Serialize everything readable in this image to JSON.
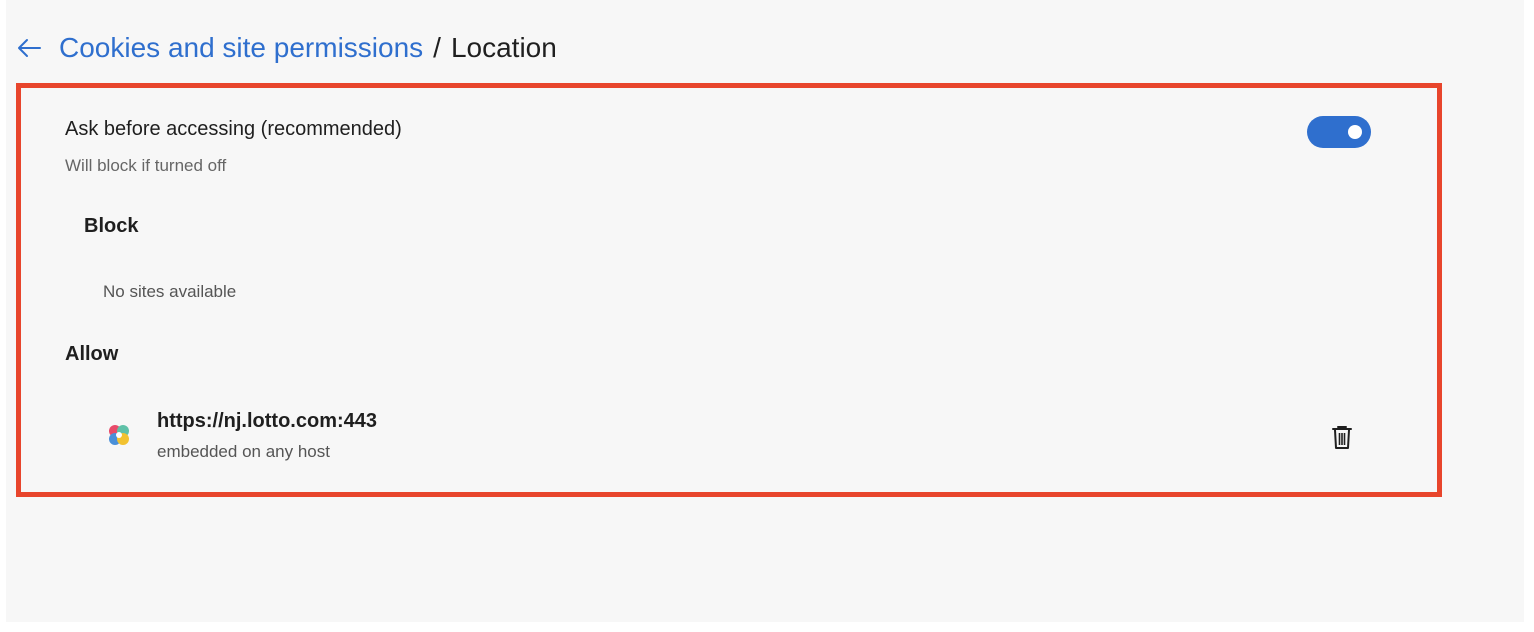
{
  "header": {
    "back_icon": "arrow-left-icon",
    "breadcrumb_parent": "Cookies and site permissions",
    "breadcrumb_separator": "/",
    "breadcrumb_current": "Location"
  },
  "ask_setting": {
    "title": "Ask before accessing (recommended)",
    "subtitle": "Will block if turned off",
    "toggle_on": true
  },
  "block_section": {
    "heading": "Block",
    "empty_text": "No sites available"
  },
  "allow_section": {
    "heading": "Allow",
    "sites": [
      {
        "url": "https://nj.lotto.com:443",
        "detail": "embedded on any host",
        "icon": "clover-favicon-icon",
        "delete_icon": "trash-icon"
      }
    ]
  },
  "colors": {
    "accent": "#2f6fce",
    "highlight_border": "#e8452c",
    "background": "#f7f7f7"
  }
}
